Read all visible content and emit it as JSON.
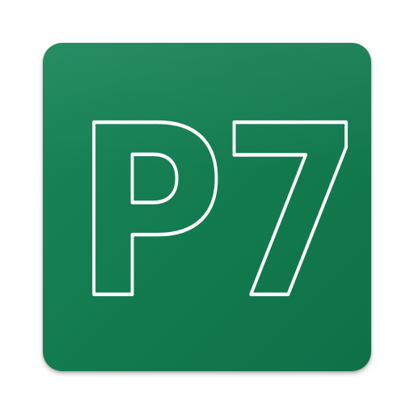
{
  "app_icon": {
    "logo_text": "P7",
    "background_color": "#127a4e",
    "outline_color": "#ffffff"
  }
}
